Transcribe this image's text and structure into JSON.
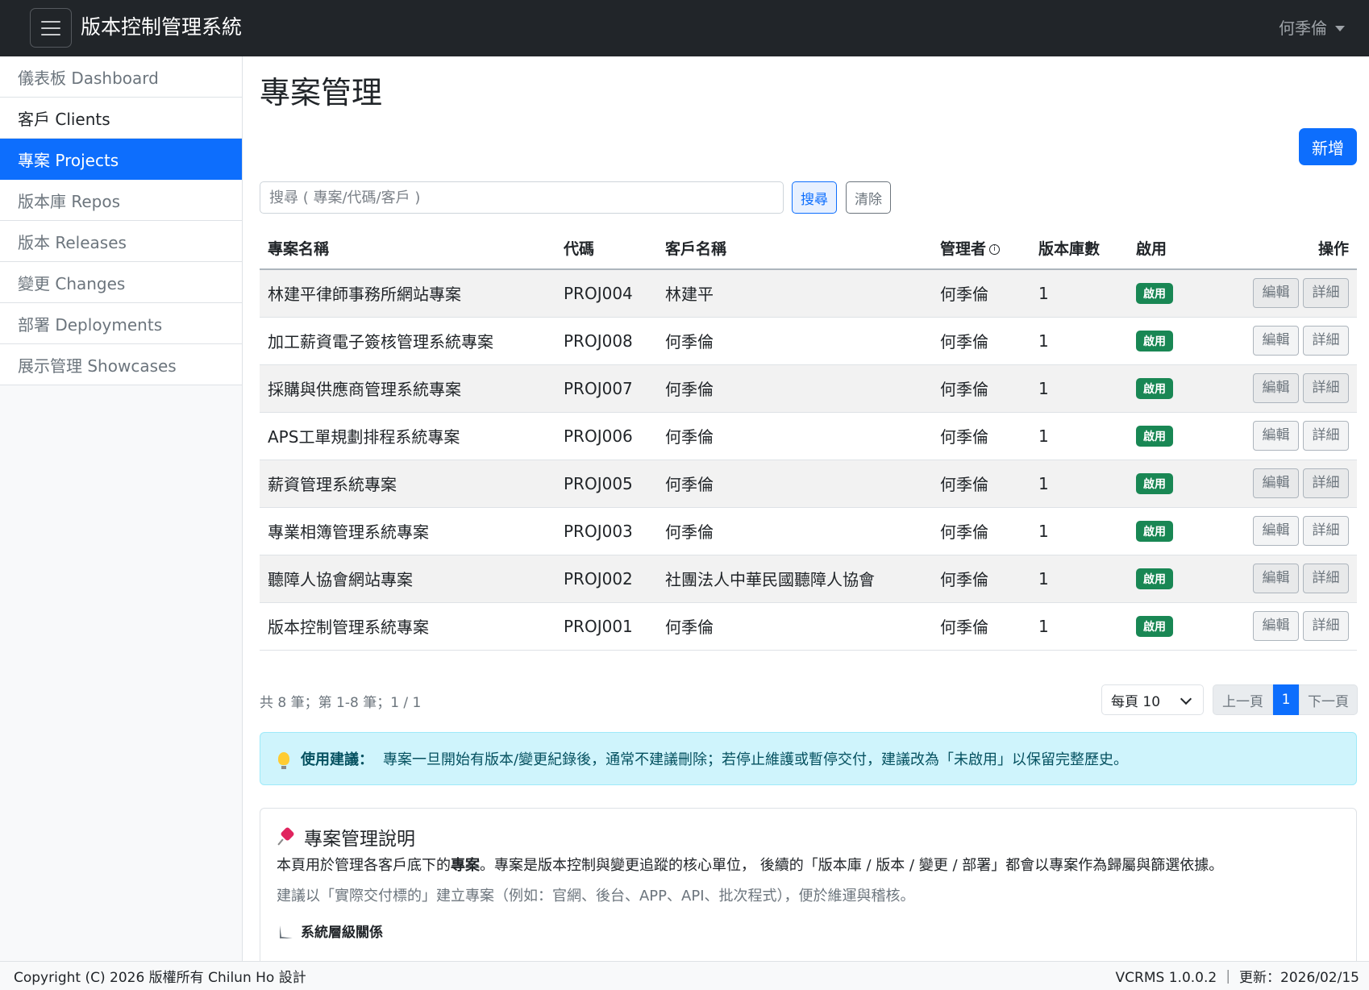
{
  "header": {
    "brand": "版本控制管理系統",
    "user": "何季倫"
  },
  "sidebar": {
    "items": [
      {
        "label": "儀表板 Dashboard"
      },
      {
        "label": "客戶 Clients"
      },
      {
        "label": "專案 Projects"
      },
      {
        "label": "版本庫 Repos"
      },
      {
        "label": "版本 Releases"
      },
      {
        "label": "變更 Changes"
      },
      {
        "label": "部署 Deployments"
      },
      {
        "label": "展示管理 Showcases"
      }
    ],
    "active_index": 2
  },
  "page": {
    "title": "專案管理",
    "new_label": "新增"
  },
  "search": {
    "placeholder": "搜尋 ( 專案/代碼/客戶 )",
    "search_label": "搜尋",
    "clear_label": "清除"
  },
  "table": {
    "headers": {
      "name": "專案名稱",
      "code": "代碼",
      "client": "客戶名稱",
      "manager": "管理者",
      "repos": "版本庫數",
      "enabled": "啟用",
      "ops": "操作"
    },
    "rows": [
      {
        "name": "林建平律師事務所網站專案",
        "code": "PROJ004",
        "client": "林建平",
        "manager": "何季倫",
        "repos": "1",
        "status": "啟用",
        "edit": "編輯",
        "detail": "詳細"
      },
      {
        "name": "加工薪資電子簽核管理系統專案",
        "code": "PROJ008",
        "client": "何季倫",
        "manager": "何季倫",
        "repos": "1",
        "status": "啟用",
        "edit": "編輯",
        "detail": "詳細"
      },
      {
        "name": "採購與供應商管理系統專案",
        "code": "PROJ007",
        "client": "何季倫",
        "manager": "何季倫",
        "repos": "1",
        "status": "啟用",
        "edit": "編輯",
        "detail": "詳細"
      },
      {
        "name": "APS工單規劃排程系統專案",
        "code": "PROJ006",
        "client": "何季倫",
        "manager": "何季倫",
        "repos": "1",
        "status": "啟用",
        "edit": "編輯",
        "detail": "詳細"
      },
      {
        "name": "薪資管理系統專案",
        "code": "PROJ005",
        "client": "何季倫",
        "manager": "何季倫",
        "repos": "1",
        "status": "啟用",
        "edit": "編輯",
        "detail": "詳細"
      },
      {
        "name": "專業相簿管理系統專案",
        "code": "PROJ003",
        "client": "何季倫",
        "manager": "何季倫",
        "repos": "1",
        "status": "啟用",
        "edit": "編輯",
        "detail": "詳細"
      },
      {
        "name": "聽障人協會網站專案",
        "code": "PROJ002",
        "client": "社團法人中華民國聽障人協會",
        "manager": "何季倫",
        "repos": "1",
        "status": "啟用",
        "edit": "編輯",
        "detail": "詳細"
      },
      {
        "name": "版本控制管理系統專案",
        "code": "PROJ001",
        "client": "何季倫",
        "manager": "何季倫",
        "repos": "1",
        "status": "啟用",
        "edit": "編輯",
        "detail": "詳細"
      }
    ]
  },
  "pagination": {
    "summary": "共 8 筆；第 1-8 筆；1 / 1",
    "per_page": "每頁 10",
    "prev": "上一頁",
    "current": "1",
    "next": "下一頁"
  },
  "tip": {
    "label": "使用建議：",
    "text": "專案一旦開始有版本/變更紀錄後，通常不建議刪除；若停止維護或暫停交付，建議改為「未啟用」以保留完整歷史。"
  },
  "info_card": {
    "title": "專案管理說明",
    "p1_a": "本頁用於管理各客戶底下的",
    "p1_b": "專案",
    "p1_c": "。專案是版本控制與變更追蹤的核心單位， 後續的「版本庫 / 版本 / 變更 / 部署」都會以專案作為歸屬與篩選依據。",
    "p2": "建議以「實際交付標的」建立專案（例如：官網、後台、APP、API、批次程式），便於維運與稽核。",
    "subheading": "系統層級關係"
  },
  "footer": {
    "copyright": "Copyright (C) 2026 版權所有 Chilun Ho 設計",
    "version": "VCRMS 1.0.0.2 ｜ 更新：2026/02/15"
  },
  "colors": {
    "primary": "#0d6efd",
    "success": "#198754",
    "navbar": "#212529",
    "info_bg": "#cff4fc"
  }
}
